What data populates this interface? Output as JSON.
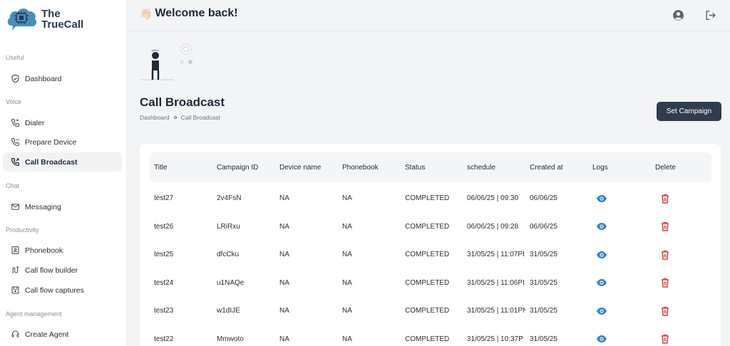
{
  "app": {
    "name_line1": "The",
    "name_line2": "TrueCall"
  },
  "sidebar": {
    "sections": [
      {
        "label": "Useful",
        "items": [
          {
            "label": "Dashboard",
            "icon": "shield-icon"
          }
        ]
      },
      {
        "label": "Voice",
        "items": [
          {
            "label": "Dialer",
            "icon": "phone-icon"
          },
          {
            "label": "Prepare Device",
            "icon": "phone-settings-icon"
          },
          {
            "label": "Call Broadcast",
            "icon": "phone-forward-icon",
            "active": true
          }
        ]
      },
      {
        "label": "Chat",
        "items": [
          {
            "label": "Messaging",
            "icon": "mail-icon"
          }
        ]
      },
      {
        "label": "Productivity",
        "items": [
          {
            "label": "Phonebook",
            "icon": "contact-book-icon"
          },
          {
            "label": "Call flow builder",
            "icon": "flow-icon"
          },
          {
            "label": "Call flow captures",
            "icon": "save-icon"
          }
        ]
      },
      {
        "label": "Agent management",
        "items": [
          {
            "label": "Create Agent",
            "icon": "headset-icon"
          }
        ]
      }
    ]
  },
  "header": {
    "wave": "👋🏻",
    "welcome": "Welcome back!"
  },
  "page": {
    "title": "Call Broadcast",
    "breadcrumb": [
      "Dashboard",
      "Call Broadcast"
    ],
    "set_campaign_label": "Set Campaign"
  },
  "table": {
    "columns": [
      "Title",
      "Campaign ID",
      "Device name",
      "Phonebook",
      "Status",
      "schedule",
      "Created at",
      "Logs",
      "Delete"
    ],
    "rows": [
      {
        "title": "test27",
        "campaign_id": "2v4FsN",
        "device": "NA",
        "phonebook": "NA",
        "status": "COMPLETED",
        "schedule": "06/06/25 | 09:30",
        "created": "06/06/25"
      },
      {
        "title": "test26",
        "campaign_id": "LRiRxu",
        "device": "NA",
        "phonebook": "NA",
        "status": "COMPLETED",
        "schedule": "06/06/25 | 09:28",
        "created": "06/06/25"
      },
      {
        "title": "test25",
        "campaign_id": "dfcCku",
        "device": "NA",
        "phonebook": "NA",
        "status": "COMPLETED",
        "schedule": "31/05/25 | 11:07PI",
        "created": "31/05/25"
      },
      {
        "title": "test24",
        "campaign_id": "u1NAQe",
        "device": "NA",
        "phonebook": "NA",
        "status": "COMPLETED",
        "schedule": "31/05/25 | 11:06PI",
        "created": "31/05/25"
      },
      {
        "title": "test23",
        "campaign_id": "w1dIJE",
        "device": "NA",
        "phonebook": "NA",
        "status": "COMPLETED",
        "schedule": "31/05/25 | 11:01PN",
        "created": "31/05/25"
      },
      {
        "title": "test22",
        "campaign_id": "Mmwoto",
        "device": "NA",
        "phonebook": "NA",
        "status": "COMPLETED",
        "schedule": "31/05/25 | 10:37P",
        "created": "31/05/25"
      }
    ]
  },
  "colors": {
    "accent": "#2f3d4f",
    "logo_blue": "#4a8fb8",
    "eye_blue": "#2f80d1",
    "delete_red": "#d63b3b"
  }
}
